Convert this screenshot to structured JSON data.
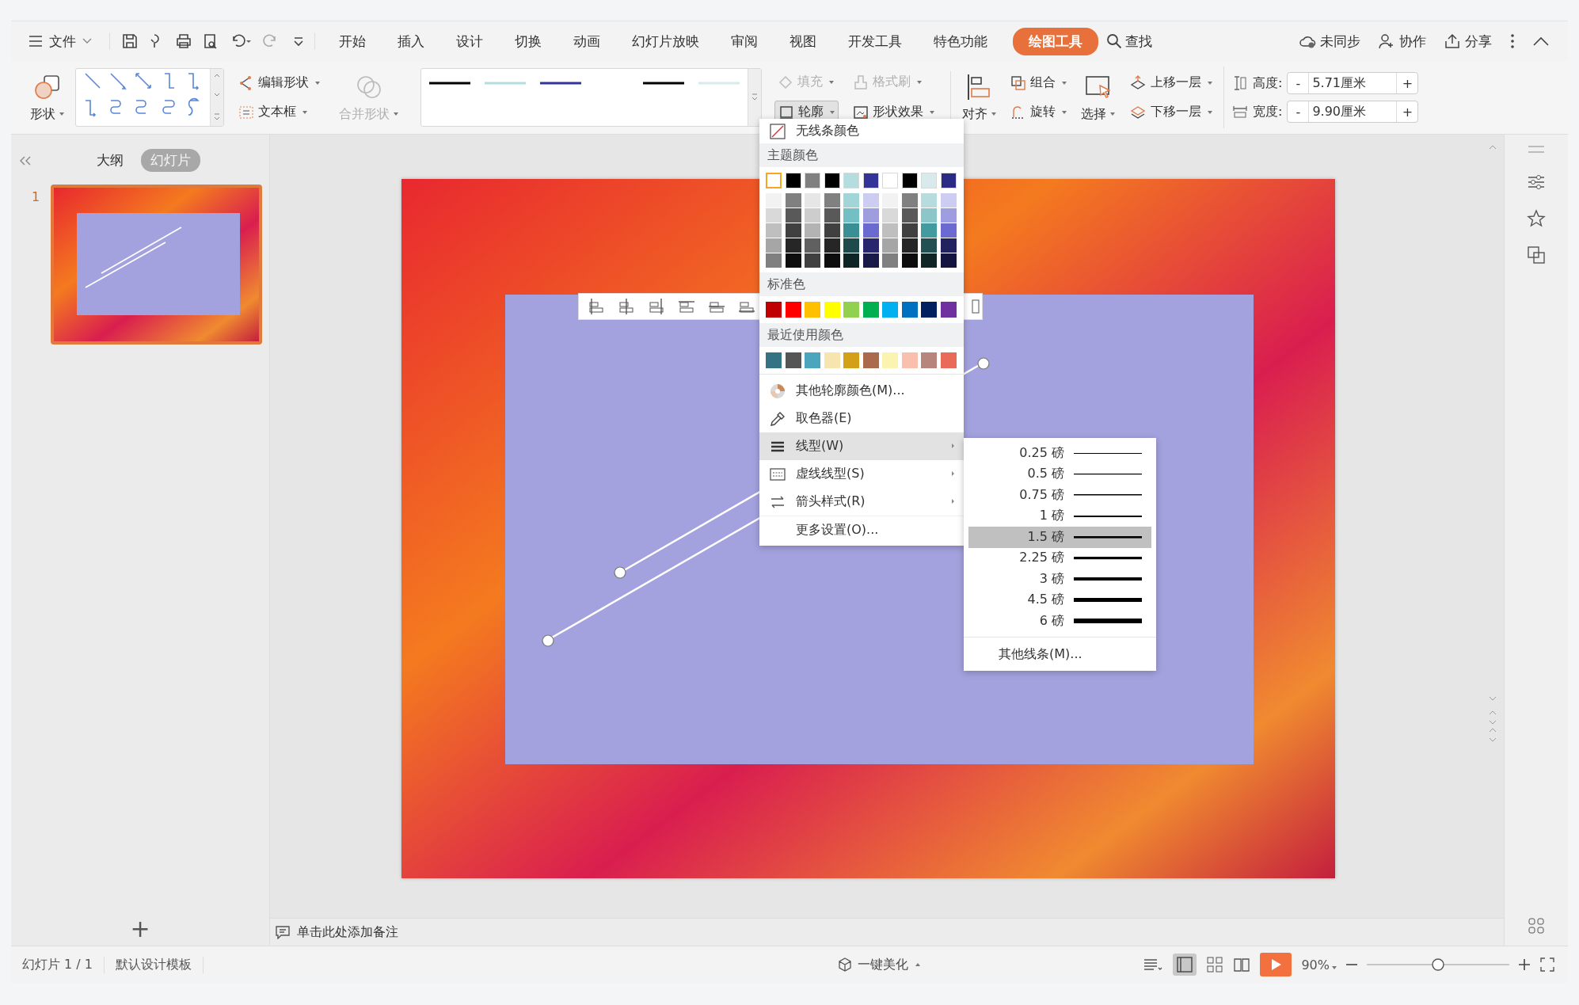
{
  "menu_bar": {
    "file": "文件",
    "tabs": [
      {
        "label": "开始",
        "selected": false
      },
      {
        "label": "插入",
        "selected": false
      },
      {
        "label": "设计",
        "selected": false
      },
      {
        "label": "切换",
        "selected": false
      },
      {
        "label": "动画",
        "selected": false
      },
      {
        "label": "幻灯片放映",
        "selected": false
      },
      {
        "label": "审阅",
        "selected": false
      },
      {
        "label": "视图",
        "selected": false
      },
      {
        "label": "开发工具",
        "selected": false
      },
      {
        "label": "特色功能",
        "selected": false
      },
      {
        "label": "绘图工具",
        "selected": true
      }
    ],
    "search": "查找",
    "actions": [
      {
        "kind": "cloud",
        "label": "未同步"
      },
      {
        "kind": "person",
        "label": "协作"
      },
      {
        "kind": "share",
        "label": "分享"
      }
    ]
  },
  "ribbon": {
    "shape_button": {
      "label": "形状"
    },
    "tools": [
      {
        "kind": "edit-shape",
        "label": "编辑形状",
        "disabled": false
      },
      {
        "kind": "textbox",
        "label": "文本框",
        "disabled": false
      }
    ],
    "merge": {
      "label": "合并形状",
      "disabled": true
    },
    "line_gallery": [
      {
        "color": "#000000"
      },
      {
        "color": "#b4dde0"
      },
      {
        "color": "#343398"
      },
      {
        "color": "#000000"
      },
      {
        "color": "#d9eaec"
      }
    ],
    "format": [
      {
        "kind": "fill",
        "label": "填充",
        "disabled": true,
        "pressed": false
      },
      {
        "kind": "brush",
        "label": "格式刷",
        "disabled": true,
        "pressed": false
      },
      {
        "kind": "outline",
        "label": "轮廓",
        "disabled": false,
        "pressed": true
      },
      {
        "kind": "effect",
        "label": "形状效果",
        "disabled": false,
        "pressed": false
      }
    ],
    "align": {
      "label": "对齐"
    },
    "arrange": [
      {
        "kind": "group",
        "label": "组合"
      },
      {
        "kind": "rotate",
        "label": "旋转"
      }
    ],
    "select": {
      "label": "选择"
    },
    "layers": [
      {
        "kind": "raise",
        "label": "上移一层"
      },
      {
        "kind": "lower",
        "label": "下移一层"
      }
    ],
    "size": [
      {
        "kind": "height",
        "label": "高度:",
        "value": "5.71厘米",
        "minus": "-",
        "plus": "+"
      },
      {
        "kind": "width",
        "label": "宽度:",
        "value": "9.90厘米",
        "minus": "-",
        "plus": "+"
      }
    ]
  },
  "left_panel": {
    "tabs": [
      {
        "label": "大纲",
        "selected": false
      },
      {
        "label": "幻灯片",
        "selected": true
      }
    ],
    "slides": [
      {
        "number": "1",
        "selected": true
      }
    ],
    "add": "+"
  },
  "outline_menu": {
    "no_line": "无线条颜色",
    "theme_title": "主题颜色",
    "theme_top": [
      {
        "color": "#ffffff",
        "selected": true
      },
      {
        "color": "#000000",
        "selected": false
      },
      {
        "color": "#808080",
        "selected": false
      },
      {
        "color": "#000000",
        "selected": false
      },
      {
        "color": "#b4dde0",
        "selected": false
      },
      {
        "color": "#343398",
        "selected": false
      },
      {
        "color": "#ffffff",
        "selected": false
      },
      {
        "color": "#000000",
        "selected": false
      },
      {
        "color": "#d9eaec",
        "selected": false
      },
      {
        "color": "#2b2a85",
        "selected": false
      }
    ],
    "theme_shades": [
      [
        {
          "color": "#f2f2f2"
        },
        {
          "color": "#808080"
        },
        {
          "color": "#e6e6e6"
        },
        {
          "color": "#808080"
        },
        {
          "color": "#a1d5d8"
        },
        {
          "color": "#cccdf0"
        },
        {
          "color": "#f2f2f2"
        },
        {
          "color": "#808080"
        },
        {
          "color": "#b8dcdd"
        },
        {
          "color": "#cccdf0"
        }
      ],
      [
        {
          "color": "#d9d9d9"
        },
        {
          "color": "#595959"
        },
        {
          "color": "#cdcdcd"
        },
        {
          "color": "#595959"
        },
        {
          "color": "#73bfc4"
        },
        {
          "color": "#9e9de0"
        },
        {
          "color": "#d9d9d9"
        },
        {
          "color": "#595959"
        },
        {
          "color": "#8cc6c8"
        },
        {
          "color": "#9e9de0"
        }
      ],
      [
        {
          "color": "#bfbfbf"
        },
        {
          "color": "#404040"
        },
        {
          "color": "#b3b3b3"
        },
        {
          "color": "#404040"
        },
        {
          "color": "#3a8f94"
        },
        {
          "color": "#6b6ad0"
        },
        {
          "color": "#bfbfbf"
        },
        {
          "color": "#404040"
        },
        {
          "color": "#449b9f"
        },
        {
          "color": "#6b6ad0"
        }
      ],
      [
        {
          "color": "#a6a6a6"
        },
        {
          "color": "#262626"
        },
        {
          "color": "#606060"
        },
        {
          "color": "#262626"
        },
        {
          "color": "#1e4a4c"
        },
        {
          "color": "#27266f"
        },
        {
          "color": "#a6a6a6"
        },
        {
          "color": "#262626"
        },
        {
          "color": "#224f52"
        },
        {
          "color": "#22225f"
        }
      ],
      [
        {
          "color": "#808080"
        },
        {
          "color": "#0d0d0d"
        },
        {
          "color": "#404040"
        },
        {
          "color": "#0d0d0d"
        },
        {
          "color": "#0e2526"
        },
        {
          "color": "#1a1a4a"
        },
        {
          "color": "#808080"
        },
        {
          "color": "#0d0d0d"
        },
        {
          "color": "#0f2526"
        },
        {
          "color": "#141440"
        }
      ]
    ],
    "standard_title": "标准色",
    "standard": [
      {
        "color": "#c00000"
      },
      {
        "color": "#ff0000"
      },
      {
        "color": "#ffc000"
      },
      {
        "color": "#ffff00"
      },
      {
        "color": "#92d050"
      },
      {
        "color": "#00b050"
      },
      {
        "color": "#00b0f0"
      },
      {
        "color": "#0070c0"
      },
      {
        "color": "#002060"
      },
      {
        "color": "#7030a0"
      }
    ],
    "recent_title": "最近使用颜色",
    "recent": [
      {
        "color": "#337383"
      },
      {
        "color": "#555555"
      },
      {
        "color": "#4ba6bd"
      },
      {
        "color": "#f7e5b0"
      },
      {
        "color": "#d4a017"
      },
      {
        "color": "#ab6a4b"
      },
      {
        "color": "#fbf3b0"
      },
      {
        "color": "#fbbfae"
      },
      {
        "color": "#b8857c"
      },
      {
        "color": "#ea6a5a"
      }
    ],
    "items": [
      {
        "kind": "palette",
        "label": "其他轮廓颜色(M)...",
        "submenu": false,
        "selected": false
      },
      {
        "kind": "eyedropper",
        "label": "取色器(E)",
        "submenu": false,
        "selected": false
      },
      {
        "kind": "lines",
        "label": "线型(W)",
        "submenu": true,
        "selected": true
      },
      {
        "kind": "dash",
        "label": "虚线线型(S)",
        "submenu": true,
        "selected": false
      },
      {
        "kind": "arrows",
        "label": "箭头样式(R)",
        "submenu": true,
        "selected": false
      },
      {
        "kind": "plain",
        "label": "更多设置(O)...",
        "submenu": false,
        "selected": false
      }
    ]
  },
  "weight_menu": {
    "items": [
      {
        "label": "0.25 磅",
        "selected": false
      },
      {
        "label": "0.5 磅",
        "selected": false
      },
      {
        "label": "0.75 磅",
        "selected": false
      },
      {
        "label": "1 磅",
        "selected": false
      },
      {
        "label": "1.5 磅",
        "selected": true
      },
      {
        "label": "2.25 磅",
        "selected": false
      },
      {
        "label": "3 磅",
        "selected": false
      },
      {
        "label": "4.5 磅",
        "selected": false
      },
      {
        "label": "6 磅",
        "selected": false
      }
    ],
    "more": "其他线条(M)..."
  },
  "notes": "单击此处添加备注",
  "status_bar": {
    "slide": "幻灯片 1 / 1",
    "template": "默认设计模板",
    "beautify": "一键美化",
    "zoom": "90%",
    "zoom_slider": {
      "level": 0.5
    }
  }
}
